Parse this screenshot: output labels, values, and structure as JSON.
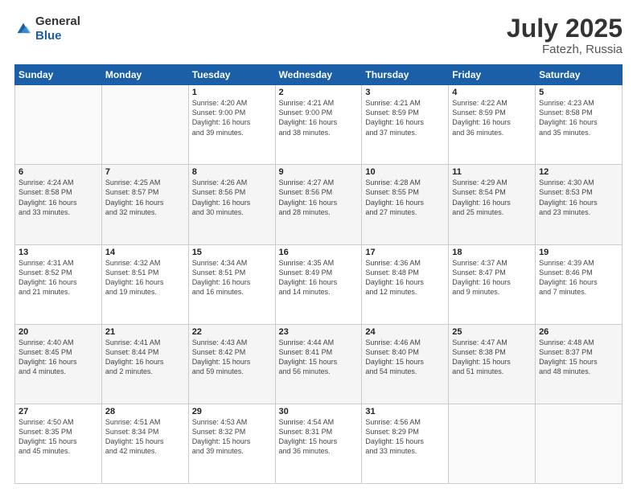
{
  "header": {
    "logo_general": "General",
    "logo_blue": "Blue",
    "month": "July 2025",
    "location": "Fatezh, Russia"
  },
  "weekdays": [
    "Sunday",
    "Monday",
    "Tuesday",
    "Wednesday",
    "Thursday",
    "Friday",
    "Saturday"
  ],
  "weeks": [
    [
      {
        "day": "",
        "info": ""
      },
      {
        "day": "",
        "info": ""
      },
      {
        "day": "1",
        "info": "Sunrise: 4:20 AM\nSunset: 9:00 PM\nDaylight: 16 hours\nand 39 minutes."
      },
      {
        "day": "2",
        "info": "Sunrise: 4:21 AM\nSunset: 9:00 PM\nDaylight: 16 hours\nand 38 minutes."
      },
      {
        "day": "3",
        "info": "Sunrise: 4:21 AM\nSunset: 8:59 PM\nDaylight: 16 hours\nand 37 minutes."
      },
      {
        "day": "4",
        "info": "Sunrise: 4:22 AM\nSunset: 8:59 PM\nDaylight: 16 hours\nand 36 minutes."
      },
      {
        "day": "5",
        "info": "Sunrise: 4:23 AM\nSunset: 8:58 PM\nDaylight: 16 hours\nand 35 minutes."
      }
    ],
    [
      {
        "day": "6",
        "info": "Sunrise: 4:24 AM\nSunset: 8:58 PM\nDaylight: 16 hours\nand 33 minutes."
      },
      {
        "day": "7",
        "info": "Sunrise: 4:25 AM\nSunset: 8:57 PM\nDaylight: 16 hours\nand 32 minutes."
      },
      {
        "day": "8",
        "info": "Sunrise: 4:26 AM\nSunset: 8:56 PM\nDaylight: 16 hours\nand 30 minutes."
      },
      {
        "day": "9",
        "info": "Sunrise: 4:27 AM\nSunset: 8:56 PM\nDaylight: 16 hours\nand 28 minutes."
      },
      {
        "day": "10",
        "info": "Sunrise: 4:28 AM\nSunset: 8:55 PM\nDaylight: 16 hours\nand 27 minutes."
      },
      {
        "day": "11",
        "info": "Sunrise: 4:29 AM\nSunset: 8:54 PM\nDaylight: 16 hours\nand 25 minutes."
      },
      {
        "day": "12",
        "info": "Sunrise: 4:30 AM\nSunset: 8:53 PM\nDaylight: 16 hours\nand 23 minutes."
      }
    ],
    [
      {
        "day": "13",
        "info": "Sunrise: 4:31 AM\nSunset: 8:52 PM\nDaylight: 16 hours\nand 21 minutes."
      },
      {
        "day": "14",
        "info": "Sunrise: 4:32 AM\nSunset: 8:51 PM\nDaylight: 16 hours\nand 19 minutes."
      },
      {
        "day": "15",
        "info": "Sunrise: 4:34 AM\nSunset: 8:51 PM\nDaylight: 16 hours\nand 16 minutes."
      },
      {
        "day": "16",
        "info": "Sunrise: 4:35 AM\nSunset: 8:49 PM\nDaylight: 16 hours\nand 14 minutes."
      },
      {
        "day": "17",
        "info": "Sunrise: 4:36 AM\nSunset: 8:48 PM\nDaylight: 16 hours\nand 12 minutes."
      },
      {
        "day": "18",
        "info": "Sunrise: 4:37 AM\nSunset: 8:47 PM\nDaylight: 16 hours\nand 9 minutes."
      },
      {
        "day": "19",
        "info": "Sunrise: 4:39 AM\nSunset: 8:46 PM\nDaylight: 16 hours\nand 7 minutes."
      }
    ],
    [
      {
        "day": "20",
        "info": "Sunrise: 4:40 AM\nSunset: 8:45 PM\nDaylight: 16 hours\nand 4 minutes."
      },
      {
        "day": "21",
        "info": "Sunrise: 4:41 AM\nSunset: 8:44 PM\nDaylight: 16 hours\nand 2 minutes."
      },
      {
        "day": "22",
        "info": "Sunrise: 4:43 AM\nSunset: 8:42 PM\nDaylight: 15 hours\nand 59 minutes."
      },
      {
        "day": "23",
        "info": "Sunrise: 4:44 AM\nSunset: 8:41 PM\nDaylight: 15 hours\nand 56 minutes."
      },
      {
        "day": "24",
        "info": "Sunrise: 4:46 AM\nSunset: 8:40 PM\nDaylight: 15 hours\nand 54 minutes."
      },
      {
        "day": "25",
        "info": "Sunrise: 4:47 AM\nSunset: 8:38 PM\nDaylight: 15 hours\nand 51 minutes."
      },
      {
        "day": "26",
        "info": "Sunrise: 4:48 AM\nSunset: 8:37 PM\nDaylight: 15 hours\nand 48 minutes."
      }
    ],
    [
      {
        "day": "27",
        "info": "Sunrise: 4:50 AM\nSunset: 8:35 PM\nDaylight: 15 hours\nand 45 minutes."
      },
      {
        "day": "28",
        "info": "Sunrise: 4:51 AM\nSunset: 8:34 PM\nDaylight: 15 hours\nand 42 minutes."
      },
      {
        "day": "29",
        "info": "Sunrise: 4:53 AM\nSunset: 8:32 PM\nDaylight: 15 hours\nand 39 minutes."
      },
      {
        "day": "30",
        "info": "Sunrise: 4:54 AM\nSunset: 8:31 PM\nDaylight: 15 hours\nand 36 minutes."
      },
      {
        "day": "31",
        "info": "Sunrise: 4:56 AM\nSunset: 8:29 PM\nDaylight: 15 hours\nand 33 minutes."
      },
      {
        "day": "",
        "info": ""
      },
      {
        "day": "",
        "info": ""
      }
    ]
  ]
}
